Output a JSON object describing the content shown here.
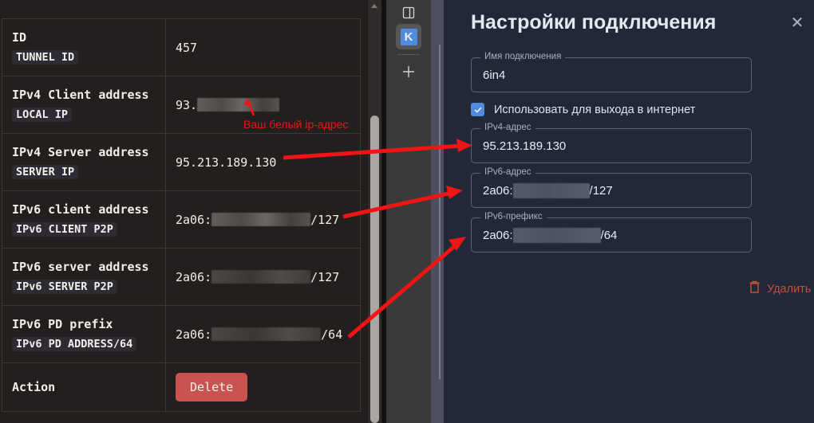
{
  "doc_table": {
    "rows": [
      {
        "key": "ID",
        "code": "TUNNEL ID",
        "value": "457",
        "redacted": false,
        "suffix": ""
      },
      {
        "key": "IPv4 Client address",
        "code": "LOCAL IP",
        "value": "93.",
        "redacted": true,
        "redact_width": 103,
        "suffix": ""
      },
      {
        "key": "IPv4 Server address",
        "code": "SERVER IP",
        "value": "95.213.189.130",
        "redacted": false,
        "suffix": ""
      },
      {
        "key": "IPv6 client address",
        "code": "IPv6 CLIENT P2P",
        "value": "2a06:",
        "redacted": true,
        "redact_width": 124,
        "suffix": "/127"
      },
      {
        "key": "IPv6 server address",
        "code": "IPv6 SERVER P2P",
        "value": "2a06:",
        "redacted": true,
        "redact_width": 124,
        "suffix": "/127"
      },
      {
        "key": "IPv6 PD prefix",
        "code": "IPv6 PD ADDRESS/64",
        "value": "2a06:",
        "redacted": true,
        "redact_width": 137,
        "suffix": "/64"
      }
    ],
    "action_key": "Action",
    "action_button": "Delete"
  },
  "annotations": {
    "white_ip": "Ваш белый ip-адрес",
    "accent_color": "#f01414"
  },
  "rail": {
    "icons": [
      {
        "name": "panel-layout-icon",
        "glyph": "panel"
      },
      {
        "name": "keenetic-logo-icon",
        "glyph": "K"
      },
      {
        "name": "add-icon",
        "glyph": "+"
      }
    ]
  },
  "panel": {
    "title": "Настройки подключения",
    "close_label": "✕",
    "fields": [
      {
        "label": "Имя подключения",
        "value": "6in4",
        "redacted": false,
        "suffix": ""
      },
      {
        "label": "IPv4-адрес",
        "value": "95.213.189.130",
        "redacted": false,
        "suffix": ""
      },
      {
        "label": "IPv6-адрес",
        "value": "2a06:",
        "redacted": true,
        "redact_width": 96,
        "suffix": "/127"
      },
      {
        "label": "IPv6-префикс",
        "value": "2a06:",
        "redacted": true,
        "redact_width": 110,
        "suffix": "/64"
      }
    ],
    "checkbox": {
      "label": "Использовать для выхода в интернет",
      "checked": true,
      "color": "#4f8ce0"
    },
    "delete": {
      "label": "Удалить",
      "color": "#c0523a",
      "icon": "trash-icon"
    },
    "background_color": "#222838"
  }
}
